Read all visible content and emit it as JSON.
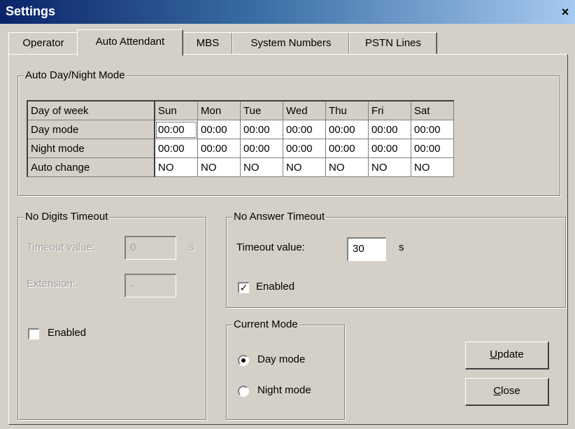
{
  "window": {
    "title": "Settings",
    "close_glyph": "×"
  },
  "tabs": [
    {
      "label": "Operator"
    },
    {
      "label": "Auto Attendant"
    },
    {
      "label": "MBS"
    },
    {
      "label": "System Numbers"
    },
    {
      "label": "PSTN Lines"
    }
  ],
  "active_tab": "Auto Attendant",
  "day_night": {
    "legend": "Auto Day/Night Mode",
    "header": [
      "Day of week",
      "Sun",
      "Mon",
      "Tue",
      "Wed",
      "Thu",
      "Fri",
      "Sat"
    ],
    "rows": [
      {
        "label": "Day mode",
        "values": [
          "00:00",
          "00:00",
          "00:00",
          "00:00",
          "00:00",
          "00:00",
          "00:00"
        ]
      },
      {
        "label": "Night mode",
        "values": [
          "00:00",
          "00:00",
          "00:00",
          "00:00",
          "00:00",
          "00:00",
          "00:00"
        ]
      },
      {
        "label": "Auto change",
        "values": [
          "NO",
          "NO",
          "NO",
          "NO",
          "NO",
          "NO",
          "NO"
        ]
      }
    ]
  },
  "no_digits": {
    "legend": "No Digits Timeout",
    "timeout_label": "Timeout value:",
    "timeout_value": "0",
    "unit": "s",
    "extension_label": "Extension:",
    "extension_value": "-",
    "enabled_label": "Enabled",
    "enabled": false
  },
  "no_answer": {
    "legend": "No Answer Timeout",
    "timeout_label": "Timeout value:",
    "timeout_value": "30",
    "unit": "s",
    "enabled_label": "Enabled",
    "enabled": true,
    "check_glyph": "✓"
  },
  "current_mode": {
    "legend": "Current Mode",
    "options": [
      "Day mode",
      "Night mode"
    ],
    "selected": "Day mode"
  },
  "buttons": {
    "update_mnemonic": "U",
    "update_rest": "pdate",
    "close_mnemonic": "C",
    "close_rest": "lose"
  }
}
